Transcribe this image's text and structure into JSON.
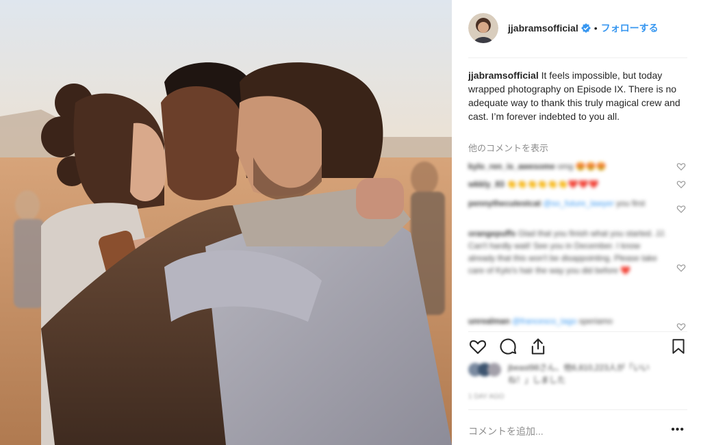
{
  "post": {
    "username": "jjabramsofficial",
    "follow_label": "フォローする",
    "caption_text": "It feels impossible, but today wrapped photography on Episode IX. There is no adequate way to thank this truly magical crew and cast. I’m forever indebted to you all.",
    "view_more_comments": "他のコメントを表示",
    "add_comment_placeholder": "コメントを追加...",
    "more_options": "•••"
  },
  "comments": [
    {
      "user": "kylo_ren_is_awesome",
      "text": "omg 😍😍😍"
    },
    {
      "user": "wkkly_83",
      "text": "👏👏👏👏👏👏❤️❤️❤️"
    },
    {
      "user": "pennythecutestcat",
      "mention": "@so_future_lawyer",
      "text": "you first"
    },
    {
      "user": "orangepuffs",
      "text": "Glad that you finish what you started. JJ. Can't hardly wait! See you in December. I know already that this won't be disappointing. Please take care of Kylo's hair the way you did before ❤️"
    },
    {
      "user": "unrealman",
      "mention": "@francesco_tago",
      "text": "speriamo"
    }
  ],
  "likes": {
    "text": "jbeast98さん、他6,810,223人が「いいね！」しました"
  },
  "time_ago": "1 DAY AGO",
  "icons": {
    "verified": "verified-badge-icon",
    "like": "heart-icon",
    "comment": "comment-bubble-icon",
    "share": "share-icon",
    "save": "bookmark-icon"
  },
  "colors": {
    "accent": "#3897f0",
    "muted": "#8e8e8e",
    "heart": "#ed4956"
  }
}
